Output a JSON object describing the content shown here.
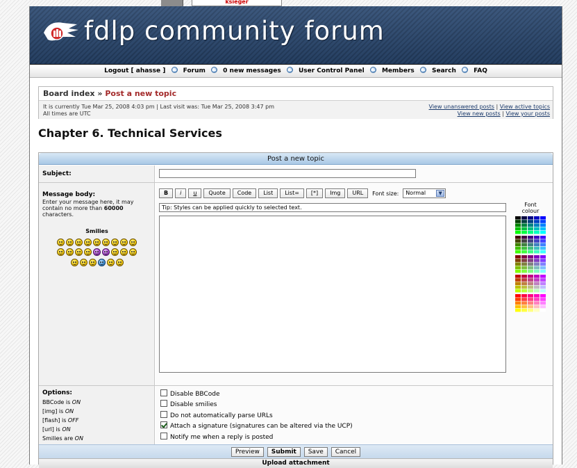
{
  "top_user": "ksieger",
  "header": {
    "title": "fdlp community forum"
  },
  "nav": {
    "logout": "Logout [ ahasse ]",
    "forum": "Forum",
    "messages": "0 new messages",
    "ucp": "User Control Panel",
    "members": "Members",
    "search": "Search",
    "faq": "FAQ"
  },
  "breadcrumb": {
    "board_index": "Board index",
    "separator": "»",
    "current": "Post a new topic"
  },
  "info": {
    "current_time": "It is currently Tue Mar 25, 2008 4:03 pm | Last visit was: Tue Mar 25, 2008 3:47 pm",
    "timezone": "All times are UTC",
    "link_unanswered": "View unanswered posts",
    "link_active": "View active topics",
    "link_new": "View new posts",
    "link_yours": "View your posts",
    "sep": "|"
  },
  "forum_title": "Chapter 6. Technical Services",
  "post": {
    "header": "Post a new topic",
    "subject_label": "Subject:",
    "subject_value": "",
    "message_label": "Message body:",
    "message_desc_1": "Enter your message here, it may",
    "message_desc_2": "contain no more than",
    "message_desc_max": "60000",
    "message_desc_3": "characters.",
    "smilies_label": "Smilies",
    "toolbar": {
      "bold": "B",
      "italic": "i",
      "underline": "u",
      "quote": "Quote",
      "code": "Code",
      "list": "List",
      "list_ordered": "List=",
      "list_item": "[*]",
      "img": "Img",
      "url": "URL",
      "font_size_label": "Font size:",
      "font_size_value": "Normal"
    },
    "tip": "Tip: Styles can be applied quickly to selected text.",
    "message_value": "",
    "font_colour_label_1": "Font",
    "font_colour_label_2": "colour",
    "options_label": "Options:",
    "options_status": [
      {
        "label": "BBCode is",
        "value": "ON"
      },
      {
        "label": "[img] is",
        "value": "ON"
      },
      {
        "label": "[flash] is",
        "value": "OFF"
      },
      {
        "label": "[url] is",
        "value": "ON"
      },
      {
        "label": "Smilies are",
        "value": "ON"
      }
    ],
    "checkboxes": [
      {
        "label": "Disable BBCode",
        "checked": false
      },
      {
        "label": "Disable smilies",
        "checked": false
      },
      {
        "label": "Do not automatically parse URLs",
        "checked": false
      },
      {
        "label": "Attach a signature (signatures can be altered via the UCP)",
        "checked": true
      },
      {
        "label": "Notify me when a reply is posted",
        "checked": false
      }
    ],
    "buttons": {
      "preview": "Preview",
      "submit": "Submit",
      "save": "Save",
      "cancel": "Cancel"
    },
    "upload": "Upload attachment"
  },
  "colors": {
    "header_bg": "#2c4a72",
    "link": "#1b3a6b",
    "crumb_current": "#a32a2a",
    "bar_blue": "#a9c8e6"
  }
}
